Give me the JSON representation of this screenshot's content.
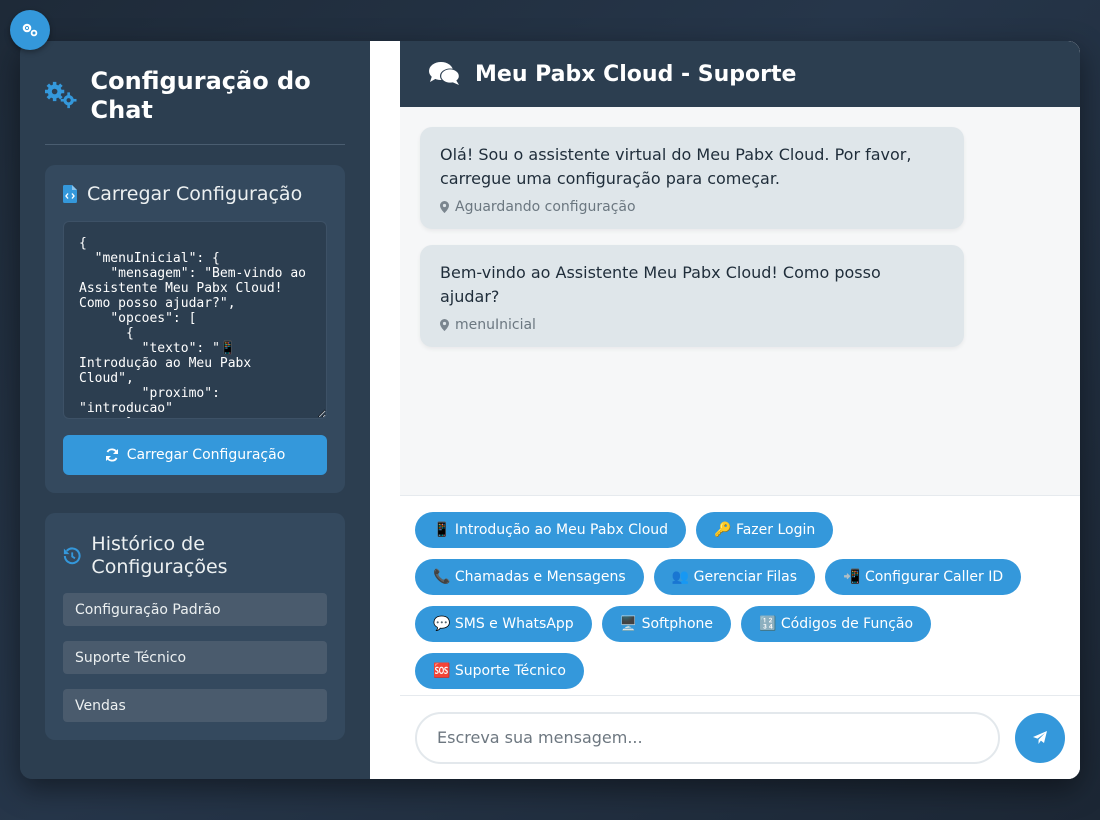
{
  "sidebar": {
    "title": "Configuração do Chat",
    "load_panel": {
      "title": "Carregar Configuração",
      "config_json": "{\n  \"menuInicial\": {\n    \"mensagem\": \"Bem-vindo ao Assistente Meu Pabx Cloud! Como posso ajudar?\",\n    \"opcoes\": [\n      {\n        \"texto\": \"📱 Introdução ao Meu Pabx Cloud\",\n        \"proximo\": \"introducao\"\n      },",
      "load_button": "Carregar Configuração"
    },
    "history": {
      "title": "Histórico de Configurações",
      "items": [
        "Configuração Padrão",
        "Suporte Técnico",
        "Vendas"
      ]
    }
  },
  "chat": {
    "title": "Meu Pabx Cloud - Suporte",
    "messages": [
      {
        "text": "Olá! Sou o assistente virtual do Meu Pabx Cloud. Por favor, carregue uma configuração para começar.",
        "meta": "Aguardando configuração"
      },
      {
        "text": "Bem-vindo ao Assistente Meu Pabx Cloud! Como posso ajudar?",
        "meta": "menuInicial"
      }
    ],
    "options": [
      "📱 Introdução ao Meu Pabx Cloud",
      "🔑 Fazer Login",
      "📞 Chamadas e Mensagens",
      "👥 Gerenciar Filas",
      "📲 Configurar Caller ID",
      "💬 SMS e WhatsApp",
      "🖥️ Softphone",
      "🔢 Códigos de Função",
      "🆘 Suporte Técnico"
    ],
    "input_placeholder": "Escreva sua mensagem..."
  },
  "colors": {
    "accent": "#3498db",
    "sidebar_bg": "#2c3e50",
    "panel_bg": "#34495e",
    "bubble_bg": "#dfe6ea"
  },
  "icons": {
    "fab": "gears-icon",
    "sidebar_title": "gears-icon",
    "load_panel": "file-code-icon",
    "load_button": "refresh-icon",
    "history": "history-icon",
    "chat_header": "comments-icon",
    "message_meta": "map-marker-icon",
    "send": "paper-plane-icon"
  }
}
